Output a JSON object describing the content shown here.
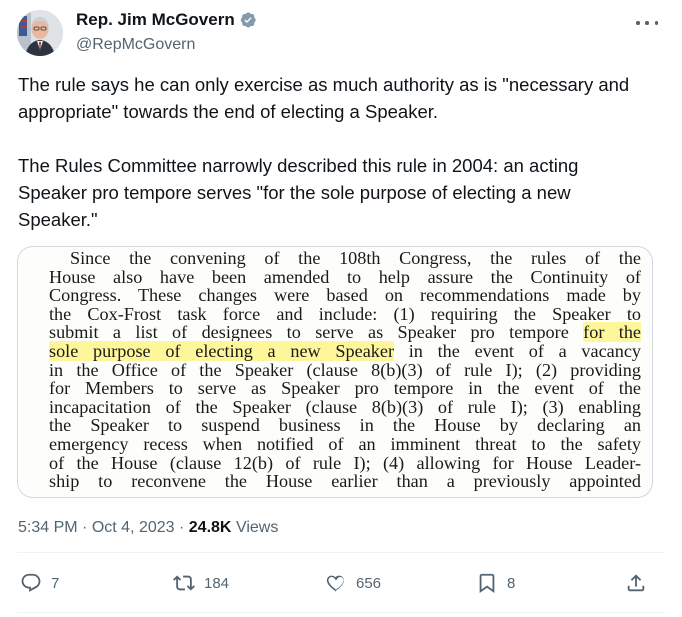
{
  "author": {
    "display_name": "Rep. Jim McGovern",
    "handle": "@RepMcGovern",
    "verified": true,
    "verified_color": "#829aab"
  },
  "tweet": {
    "paragraphs": [
      "The rule says he can only exercise as much authority as is \"necessary and appropriate\" towards the end of electing a Speaker.",
      "The Rules Committee narrowly described this rule in 2004: an acting Speaker pro tempore serves \"for the sole purpose of electing a new Speaker.\""
    ]
  },
  "media": {
    "highlight_color": "#fdf69a",
    "lines": [
      {
        "text": "Since the convening of the 108th Congress, the rules of the"
      },
      {
        "text": "House also have been amended to help assure the Continuity of"
      },
      {
        "text": "Congress. These changes were based on recommendations made by"
      },
      {
        "text": "the Cox-Frost task force and include: (1) requiring the Speaker to"
      },
      {
        "before": "submit a list of designees to serve as Speaker pro tempore ",
        "highlight": "for the"
      },
      {
        "highlight": "sole purpose of electing a new Speaker",
        "after": " in the event of a vacancy"
      },
      {
        "text": "in the Office of the Speaker (clause 8(b)(3) of rule I); (2) providing"
      },
      {
        "text": "for Members to serve as Speaker pro tempore in the event of the"
      },
      {
        "text": "incapacitation of the Speaker (clause 8(b)(3) of rule I); (3) enabling"
      },
      {
        "text": "the Speaker to suspend business in the House by declaring an"
      },
      {
        "text": "emergency recess when notified of an imminent threat to the safety"
      },
      {
        "text": "of the House (clause 12(b) of rule I); (4) allowing for House Leader-"
      },
      {
        "text": "ship to reconvene the House earlier than a previously appointed"
      }
    ]
  },
  "meta": {
    "time": "5:34 PM",
    "separator": "·",
    "date": "Oct 4, 2023",
    "views_count": "24.8K",
    "views_label": "Views"
  },
  "actions": {
    "reply_count": "7",
    "repost_count": "184",
    "like_count": "656",
    "bookmark_count": "8",
    "reply_icon": "reply-icon",
    "repost_icon": "repost-icon",
    "like_icon": "heart-icon",
    "bookmark_icon": "bookmark-icon",
    "share_icon": "share-icon"
  }
}
